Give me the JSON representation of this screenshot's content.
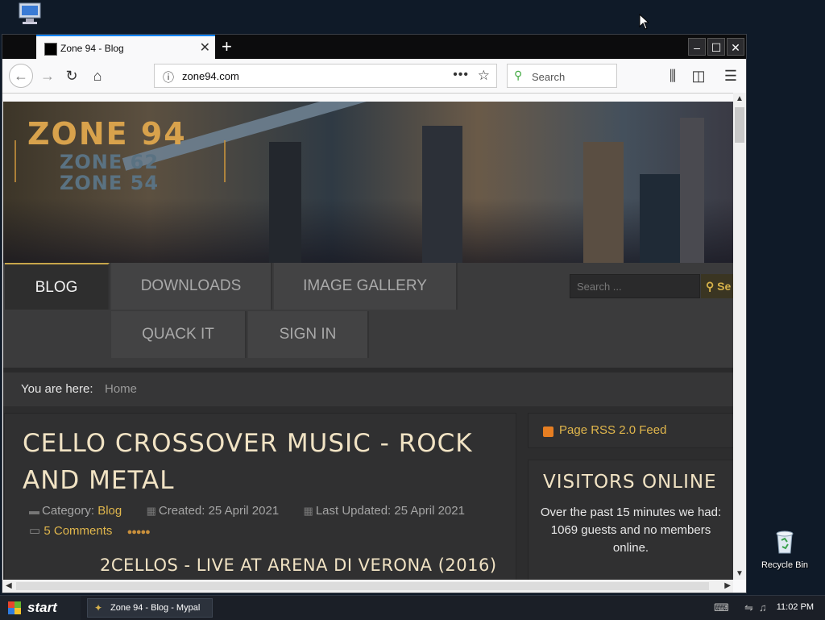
{
  "desktop": {
    "recycle_bin_label": "Recycle Bin"
  },
  "browser": {
    "tab_title": "Zone 94 - Blog",
    "url": "zone94.com",
    "search_placeholder": "Search"
  },
  "page": {
    "logo_main": "ZONE 94",
    "logo_sub1": "ZONE 62",
    "logo_sub2": "ZONE 54",
    "menu": [
      "BLOG",
      "DOWNLOADS",
      "IMAGE GALLERY",
      "QUACK IT",
      "SIGN IN"
    ],
    "search_placeholder": "Search ...",
    "search_button": "Se",
    "breadcrumb_label": "You are here:",
    "breadcrumb_current": "Home",
    "article": {
      "title": "CELLO CROSSOVER MUSIC - ROCK AND METAL",
      "category_label": "Category:",
      "category": "Blog",
      "created": "Created: 25 April 2021",
      "updated": "Last Updated: 25 April 2021",
      "comments": "5 Comments",
      "rating_stars": 5,
      "subtitle": "2CELLOS - LIVE AT ARENA DI VERONA (2016)"
    },
    "sidebar": {
      "rss": "Page RSS 2.0 Feed",
      "visitors_title": "VISITORS ONLINE",
      "visitors_text": "Over the past 15 minutes we had:",
      "visitors_count": "1069 guests and no members online."
    }
  },
  "taskbar": {
    "start": "start",
    "task": "Zone 94 - Blog - Mypal",
    "clock": "11:02 PM"
  }
}
